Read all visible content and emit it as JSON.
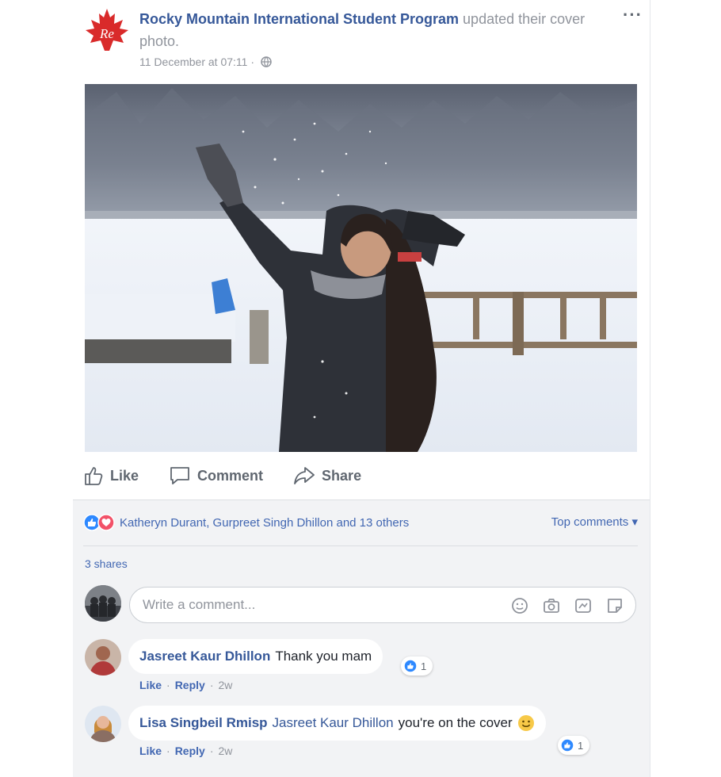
{
  "post": {
    "page_name": "Rocky Mountain International Student Program",
    "action_text": "updated their cover photo.",
    "timestamp": "11 December at 07:11 ·",
    "privacy_icon": "globe-icon",
    "more_label": "···",
    "logo_text": "Re"
  },
  "actions": {
    "like": "Like",
    "comment": "Comment",
    "share": "Share"
  },
  "reactions": {
    "names": "Katheryn Durant, Gurpreet Singh Dhillon and 13 others",
    "top_comments": "Top comments ▾",
    "shares": "3 shares"
  },
  "composer": {
    "placeholder": "Write a comment..."
  },
  "comments": [
    {
      "author": "Jasreet Kaur Dhillon",
      "mention": "",
      "text": "Thank you mam",
      "likes": "1",
      "like_label": "Like",
      "reply_label": "Reply",
      "age": "2w"
    },
    {
      "author": "Lisa Singbeil Rmisp",
      "mention": "Jasreet Kaur Dhillon",
      "text": "you're on the cover",
      "likes": "1",
      "like_label": "Like",
      "reply_label": "Reply",
      "age": "2w"
    }
  ],
  "colors": {
    "link_blue": "#365899",
    "accent_blue": "#4267b2",
    "maple_red": "#d92a2a",
    "love_red": "#f25268",
    "feedback_bg": "#f2f3f5"
  }
}
